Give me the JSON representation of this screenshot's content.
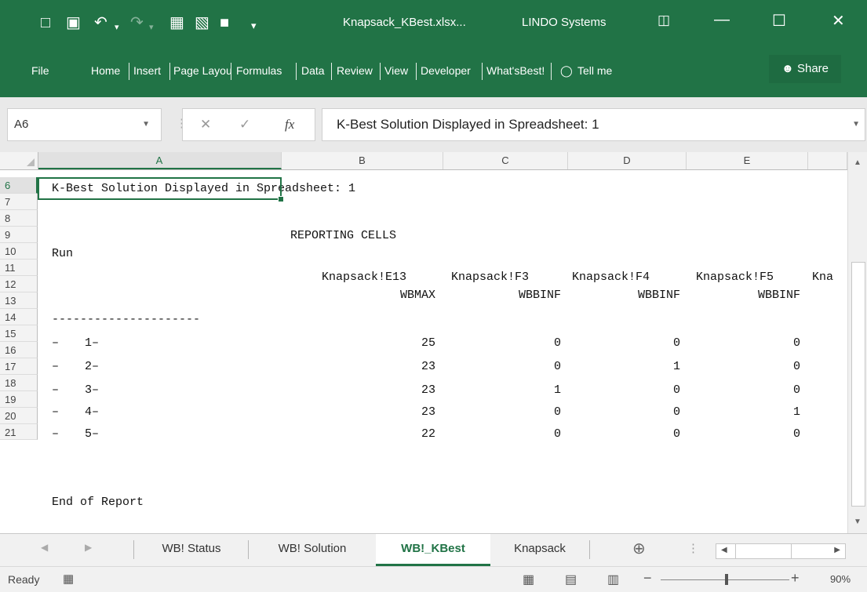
{
  "window": {
    "file_title": "Knapsack_KBest.xlsx...",
    "company": "LINDO Systems"
  },
  "ribbon": {
    "tabs": [
      "File",
      "Home",
      "Insert",
      "Page Layou",
      "Formulas",
      "Data",
      "Review",
      "View",
      "Developer",
      "What'sBest!"
    ],
    "tell_me": "Tell me",
    "share": "Share"
  },
  "formula_bar": {
    "name_box": "A6",
    "fx": "fx",
    "content": "K-Best Solution Displayed in Spreadsheet: 1"
  },
  "columns": [
    "A",
    "B",
    "C",
    "D",
    "E"
  ],
  "rows": [
    "6",
    "7",
    "8",
    "9",
    "10",
    "11",
    "12",
    "13",
    "14",
    "15",
    "16",
    "17",
    "18",
    "19",
    "20",
    "21"
  ],
  "cells": {
    "r6": "K-Best Solution Displayed in Spreadsheet: 1",
    "r8": "REPORTING CELLS",
    "r9": "Run",
    "r10": [
      "Knapsack!E13",
      "Knapsack!F3",
      "Knapsack!F4",
      "Knapsack!F5",
      "Kna"
    ],
    "r11": [
      "WBMAX",
      "WBBINF",
      "WBBINF",
      "WBBINF"
    ],
    "r12": "---------------------",
    "runs": [
      {
        "dash": "–",
        "label": "1–",
        "vals": [
          "25",
          "0",
          "0",
          "0"
        ]
      },
      {
        "dash": "–",
        "label": "2–",
        "vals": [
          "23",
          "0",
          "1",
          "0"
        ]
      },
      {
        "dash": "–",
        "label": "3–",
        "vals": [
          "23",
          "1",
          "0",
          "0"
        ]
      },
      {
        "dash": "–",
        "label": "4–",
        "vals": [
          "23",
          "0",
          "0",
          "1"
        ]
      },
      {
        "dash": "–",
        "label": "5–",
        "vals": [
          "22",
          "0",
          "0",
          "0"
        ]
      }
    ],
    "r20": "End of Report"
  },
  "sheet_tabs": [
    "WB! Status",
    "WB! Solution",
    "WB!_KBest",
    "Knapsack"
  ],
  "active_sheet_tab": "WB!_KBest",
  "status_bar": {
    "ready": "Ready",
    "zoom": "90%"
  },
  "colors": {
    "accent": "#217346"
  }
}
